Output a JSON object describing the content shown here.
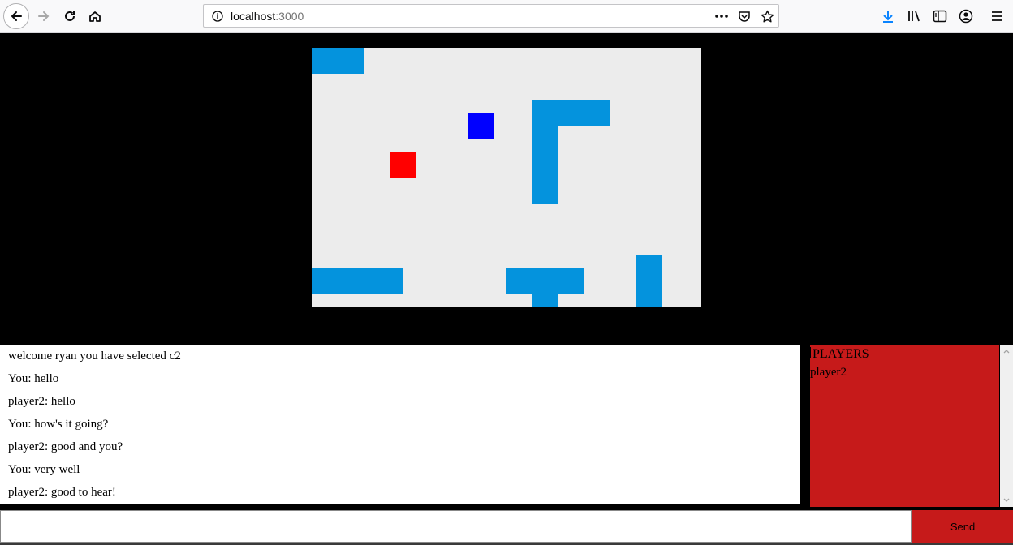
{
  "browser": {
    "url_host": "localhost",
    "url_port": ":3000",
    "icons": [
      "back-icon",
      "forward-icon",
      "reload-icon",
      "home-icon",
      "site-info-icon",
      "more-icon",
      "pocket-icon",
      "bookmark-star-icon",
      "downloads-icon",
      "library-icon",
      "sidebar-icon",
      "account-icon",
      "menu-icon"
    ]
  },
  "game": {
    "background": "#ececec",
    "wall_color": "#0493dd",
    "player_red": "#ff0000",
    "player_blue": "#0000ff"
  },
  "chat": {
    "messages": [
      "welcome ryan you have selected c2",
      "You: hello",
      "player2: hello",
      "You: how's it going?",
      "player2: good and you?",
      "You: very well",
      "player2: good to hear!"
    ]
  },
  "players": {
    "title": "PLAYERS",
    "list": [
      "player2"
    ],
    "panel_color": "#c61a1a"
  },
  "input": {
    "value": "",
    "send_label": "Send"
  }
}
